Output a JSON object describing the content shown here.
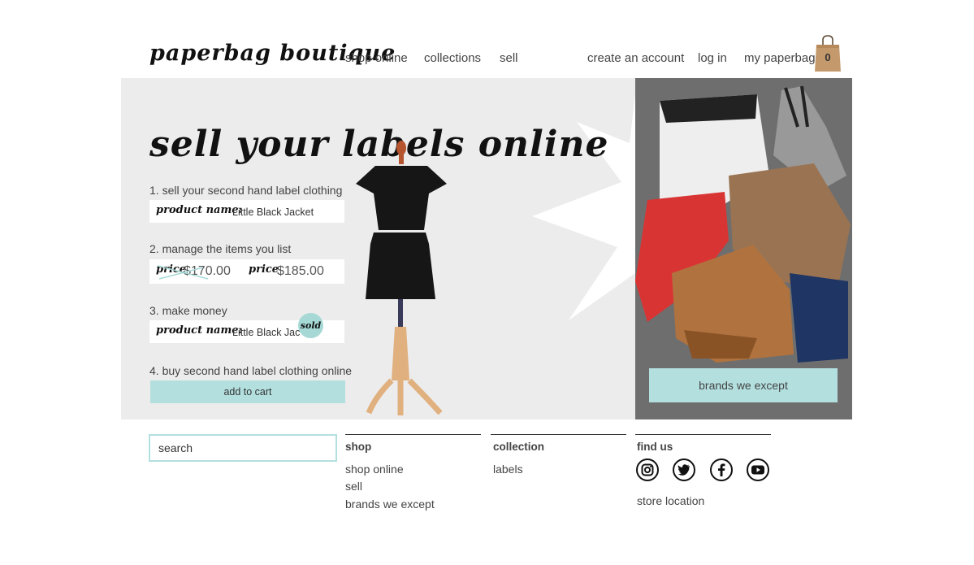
{
  "header": {
    "logo": "paperbag boutique",
    "nav": [
      "shop online",
      "collections",
      "sell"
    ],
    "account": [
      "create an account",
      "log in",
      "my paperbag"
    ],
    "cart_count": "0"
  },
  "hero": {
    "title": "sell your labels online",
    "steps": [
      "1. sell your second hand label clothing",
      "2. manage the items you list",
      "3. make money",
      "4. buy second hand label clothing online"
    ],
    "product_label": "product name:",
    "product_value": "Little Black Jacket",
    "product_value_cut": "Little Black Jac",
    "price_label": "price",
    "old_price": "$170.00",
    "new_price": "$185.00",
    "sold_badge": "sold",
    "add_to_cart": "add to cart",
    "brands_button": "brands we except"
  },
  "footer": {
    "search_placeholder": "search",
    "shop": {
      "heading": "shop",
      "links": [
        "shop online",
        "sell",
        "brands we except"
      ]
    },
    "collection": {
      "heading": "collection",
      "links": [
        "labels"
      ]
    },
    "find_us": {
      "heading": "find us",
      "social": [
        "instagram-icon",
        "twitter-icon",
        "facebook-icon",
        "youtube-icon"
      ],
      "store_link": "store location"
    }
  },
  "colors": {
    "accent": "#b3e0df",
    "hero_bg": "#ececec",
    "panel_bg": "#6e6e6e"
  }
}
